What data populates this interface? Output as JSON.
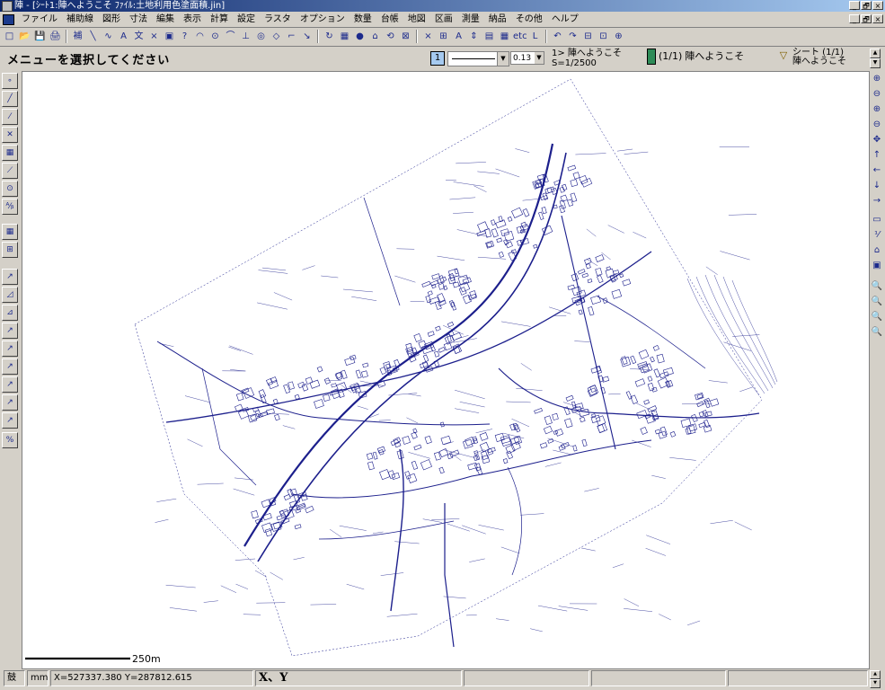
{
  "window": {
    "title": "陣 - [ｼｰﾄ1:陣へようこそ ﾌｧｲﾙ:土地利用色塗面積.jin]"
  },
  "window_buttons": [
    "_",
    "🗗",
    "×"
  ],
  "menu": [
    "ファイル",
    "補助線",
    "図形",
    "寸法",
    "編集",
    "表示",
    "計算",
    "設定",
    "ラスタ",
    "オプション",
    "数量",
    "台帳",
    "地図",
    "区画",
    "測量",
    "納品",
    "その他",
    "ヘルプ"
  ],
  "toolbar": {
    "items": [
      "□",
      "📂",
      "💾",
      "🖨",
      "補",
      "╲",
      "∿",
      "A",
      "文",
      "×",
      "▣",
      "?",
      "◠",
      "⊙",
      "⌒",
      "⊥",
      "◎",
      "◇",
      "⌐",
      "↘",
      "↻",
      "▦",
      "●",
      "⌂",
      "⟲",
      "⊠",
      "×",
      "⊞",
      "A",
      "⇕",
      "▤",
      "▦",
      "etc",
      "L",
      "↶",
      "↷",
      "⊟",
      "⊡",
      "⊕"
    ]
  },
  "prompt": "メニューを選択してください",
  "line_props": {
    "layer_number": "1",
    "width_value": "0.13"
  },
  "scale_info": {
    "line1": "1> 陣へようこそ",
    "line2": "S=1/2500"
  },
  "layer_info": {
    "count": "(1/1)",
    "name": "陣へようこそ"
  },
  "sheet_info": {
    "line1": "シート (1/1)",
    "line2": "陣へようこそ"
  },
  "left_tools": [
    "∘",
    "╱",
    "⁄",
    "✕",
    "▦",
    "⟋",
    "⊙",
    "ᴬ⁄ᵦ",
    "▦",
    "⊞",
    "↗",
    "◿",
    "⊿",
    "↗",
    "↗",
    "↗",
    "↗",
    "↗",
    "↗",
    "%"
  ],
  "right_tools": [
    "⊕",
    "⊖",
    "⊕",
    "⊖",
    "✥",
    "↑",
    "←",
    "↓",
    "→",
    "▭",
    "⅟",
    "⌂",
    "▣",
    "🔍",
    "🔍",
    "🔍",
    "🔍"
  ],
  "scale_bar": {
    "label": "250m"
  },
  "status": {
    "mode": "鼓",
    "unit": "mm",
    "coords": "X=527337.380 Y=287812.615",
    "xy_label": "X、Y"
  },
  "colors": {
    "map_line": "#1c1f8c",
    "title_start": "#0a246a",
    "title_end": "#a6caf0",
    "bg": "#d4d0c8"
  }
}
